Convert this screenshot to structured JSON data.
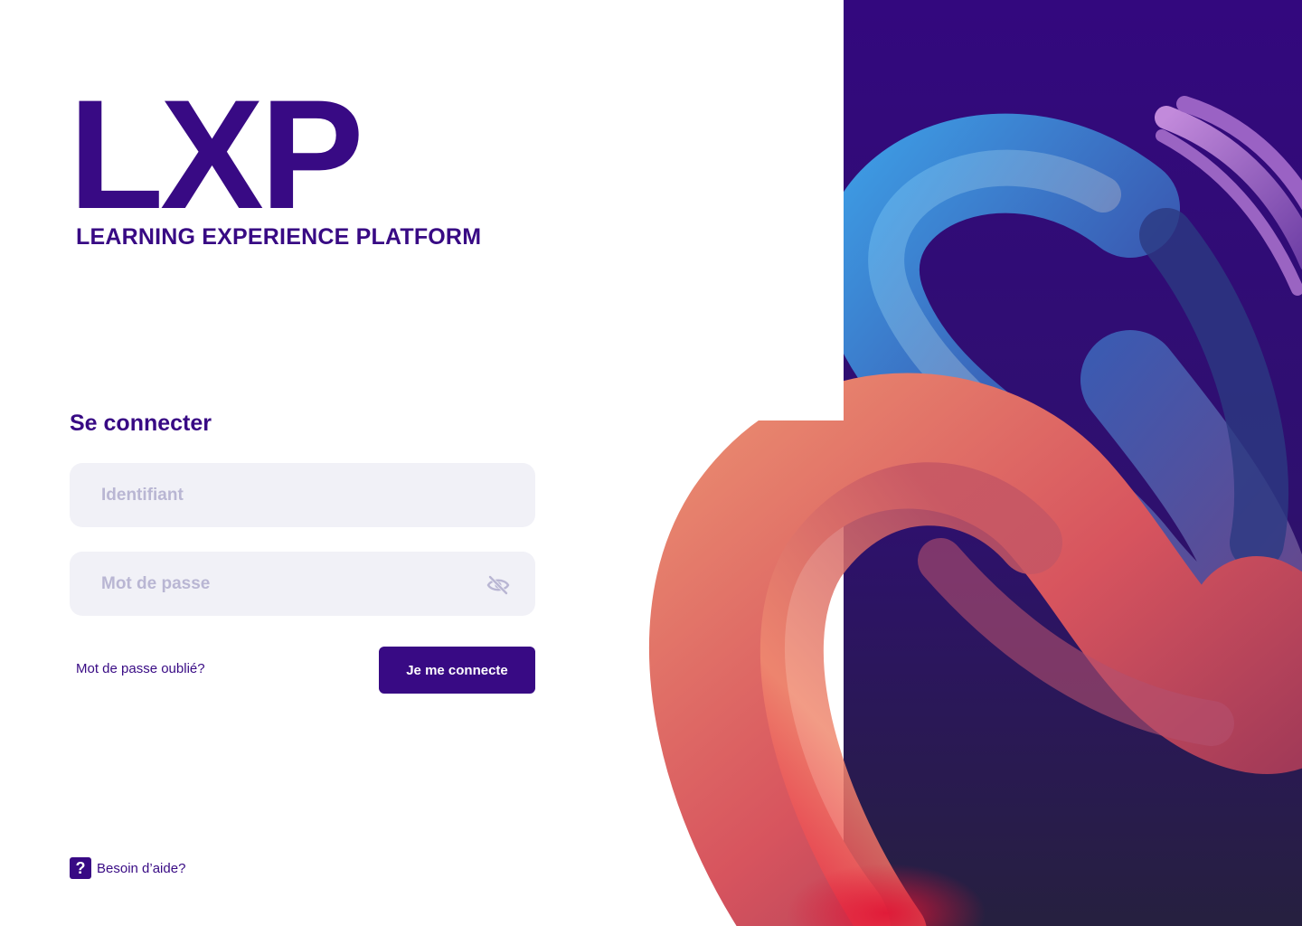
{
  "brand": {
    "logo": "LXP",
    "tagline": "LEARNING EXPERIENCE PLATFORM"
  },
  "login_form": {
    "title": "Se connecter",
    "username_placeholder": "Identifiant",
    "password_placeholder": "Mot de passe",
    "forgot_password_label": "Mot de passe oublié?",
    "submit_label": "Je me connecte"
  },
  "help": {
    "icon_glyph": "?",
    "label": "Besoin d’aide?"
  },
  "colors": {
    "brand": "#380A84",
    "field_bg": "#F1F1F7",
    "placeholder": "#B9B6D3",
    "panel_bg": "#33087E"
  },
  "icons": {
    "password_toggle": "eye-off-icon",
    "help": "question-icon"
  }
}
